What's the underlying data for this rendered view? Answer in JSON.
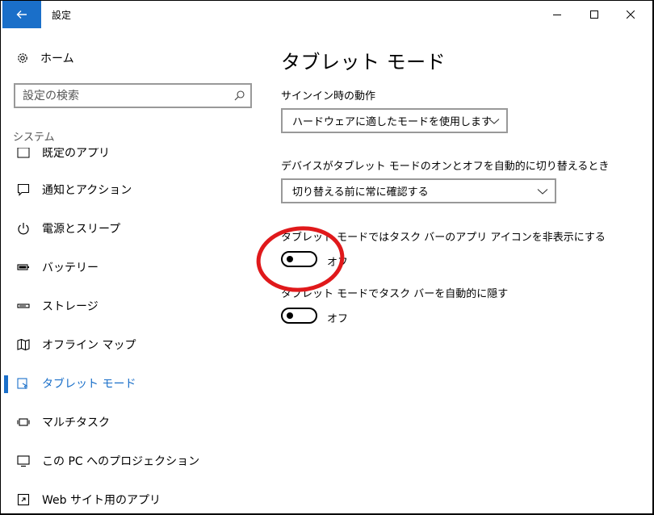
{
  "window": {
    "title": "設定",
    "accent_color": "#1a6fc9"
  },
  "sidebar": {
    "home_label": "ホーム",
    "search_placeholder": "設定の検索",
    "section_label": "システム",
    "items": [
      {
        "label": "既定のアプリ",
        "icon": "default-apps-icon"
      },
      {
        "label": "通知とアクション",
        "icon": "notification-icon"
      },
      {
        "label": "電源とスリープ",
        "icon": "power-icon"
      },
      {
        "label": "バッテリー",
        "icon": "battery-icon"
      },
      {
        "label": "ストレージ",
        "icon": "storage-icon"
      },
      {
        "label": "オフライン マップ",
        "icon": "map-icon"
      },
      {
        "label": "タブレット モード",
        "icon": "tablet-mode-icon",
        "selected": true
      },
      {
        "label": "マルチタスク",
        "icon": "multitask-icon"
      },
      {
        "label": "この PC へのプロジェクション",
        "icon": "projection-icon"
      },
      {
        "label": "Web サイト用のアプリ",
        "icon": "web-apps-icon"
      }
    ]
  },
  "main": {
    "title": "タブレット モード",
    "signin": {
      "label": "サインイン時の動作",
      "value": "ハードウェアに適したモードを使用します"
    },
    "auto_switch": {
      "label": "デバイスがタブレット モードのオンとオフを自動的に切り替えるとき",
      "value": "切り替える前に常に確認する"
    },
    "hide_icons": {
      "label": "タブレット モードではタスク バーのアプリ アイコンを非表示にする",
      "state": "オフ",
      "on": false
    },
    "auto_hide_taskbar": {
      "label": "タブレット モードでタスク バーを自動的に隠す",
      "state": "オフ",
      "on": false
    }
  },
  "annotation": {
    "color": "#e0191b"
  }
}
